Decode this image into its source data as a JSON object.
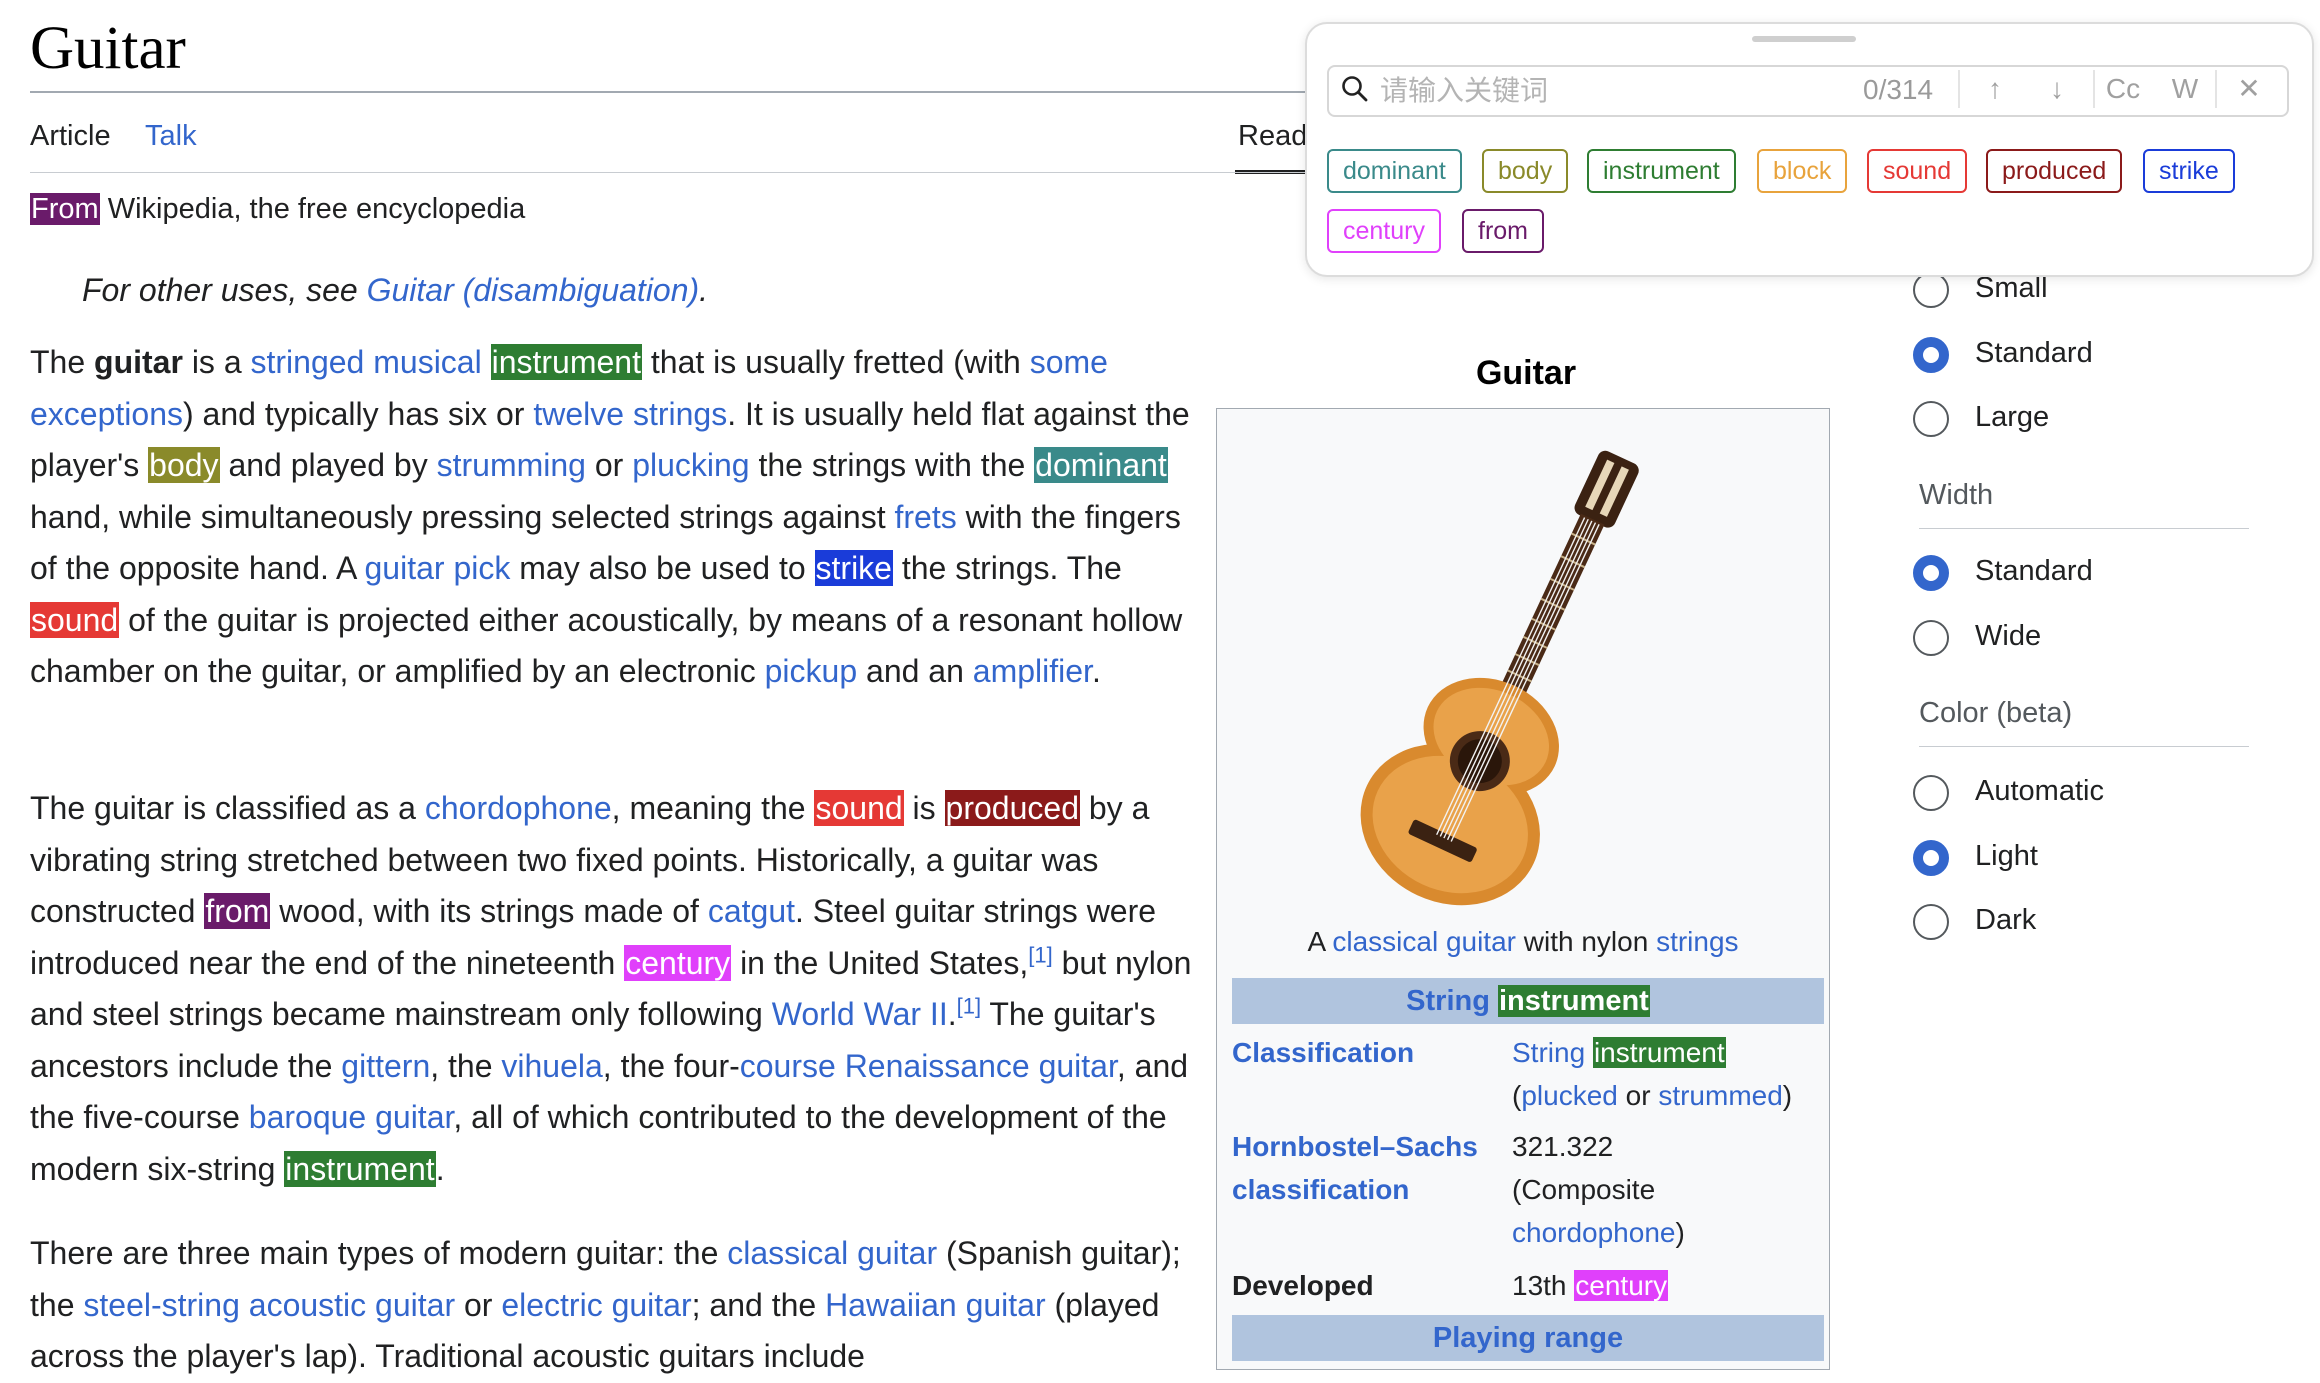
{
  "article": {
    "title": "Guitar",
    "tabs": {
      "article": "Article",
      "talk": "Talk",
      "read": "Read"
    },
    "tagline_from": "From",
    "tagline_rest": " Wikipedia, the free encyclopedia",
    "hatnote": {
      "prefix": "For other uses, see ",
      "link": "Guitar (disambiguation)",
      "suffix": "."
    }
  },
  "infobox": {
    "title": "Guitar",
    "caption": {
      "a": "A ",
      "link1": "classical guitar",
      "mid": " with nylon ",
      "link2": "strings"
    },
    "header1": {
      "link": "String",
      "hl": "instrument"
    },
    "rows": [
      {
        "label": "Classification",
        "value": "String instrument (plucked or strummed)"
      },
      {
        "label": "Hornbostel–Sachs classification",
        "value": "321.322 (Composite chordophone)"
      },
      {
        "label": "Developed",
        "value": "13th century"
      }
    ],
    "header2": "Playing range"
  },
  "appearance": {
    "text_options": [
      "Small",
      "Standard",
      "Large"
    ],
    "text_selected": "Standard",
    "width_title": "Width",
    "width_options": [
      "Standard",
      "Wide"
    ],
    "width_selected": "Standard",
    "color_title": "Color (beta)",
    "color_options": [
      "Automatic",
      "Light",
      "Dark"
    ],
    "color_selected": "Light"
  },
  "finder": {
    "placeholder": "请输入关键词",
    "counter": "0/314",
    "buttons": [
      "↑",
      "↓",
      "Cc",
      "W",
      "✕"
    ],
    "keywords": [
      {
        "text": "dominant",
        "color": "#3a8a8a"
      },
      {
        "text": "body",
        "color": "#8a8a2a"
      },
      {
        "text": "instrument",
        "color": "#2e7d32"
      },
      {
        "text": "block",
        "color": "#e8a33c"
      },
      {
        "text": "sound",
        "color": "#e53935"
      },
      {
        "text": "produced",
        "color": "#8b1a1a"
      },
      {
        "text": "strike",
        "color": "#1a3cd9"
      },
      {
        "text": "century",
        "color": "#e040fb"
      },
      {
        "text": "from",
        "color": "#6a1b6a"
      }
    ]
  }
}
